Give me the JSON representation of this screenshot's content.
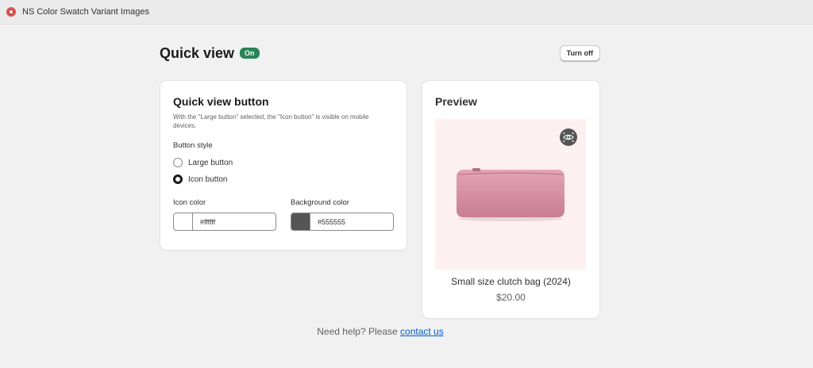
{
  "app": {
    "title": "NS Color Swatch Variant Images",
    "icon": "app-logo-icon"
  },
  "header": {
    "title": "Quick view",
    "status": "On",
    "turn_off_label": "Turn off"
  },
  "settings": {
    "title": "Quick view button",
    "description": "With the \"Large button\" selected, the \"Icon button\" is visible on mobile devices.",
    "button_style_label": "Button style",
    "options": [
      {
        "label": "Large button",
        "selected": false
      },
      {
        "label": "Icon button",
        "selected": true
      }
    ],
    "icon_color": {
      "label": "Icon color",
      "value": "#ffffff"
    },
    "background_color": {
      "label": "Background color",
      "value": "#555555"
    }
  },
  "preview": {
    "title": "Preview",
    "product_name": "Small size clutch bag (2024)",
    "price": "$20.00",
    "quick_view_icon": "eye-icon"
  },
  "help": {
    "text": "Need help? Please",
    "link": "contact us"
  },
  "colors": {
    "status_badge": "#29845a",
    "link": "#005bd3",
    "image_bg": "#fdf0f0",
    "bag": "#d993a8"
  }
}
